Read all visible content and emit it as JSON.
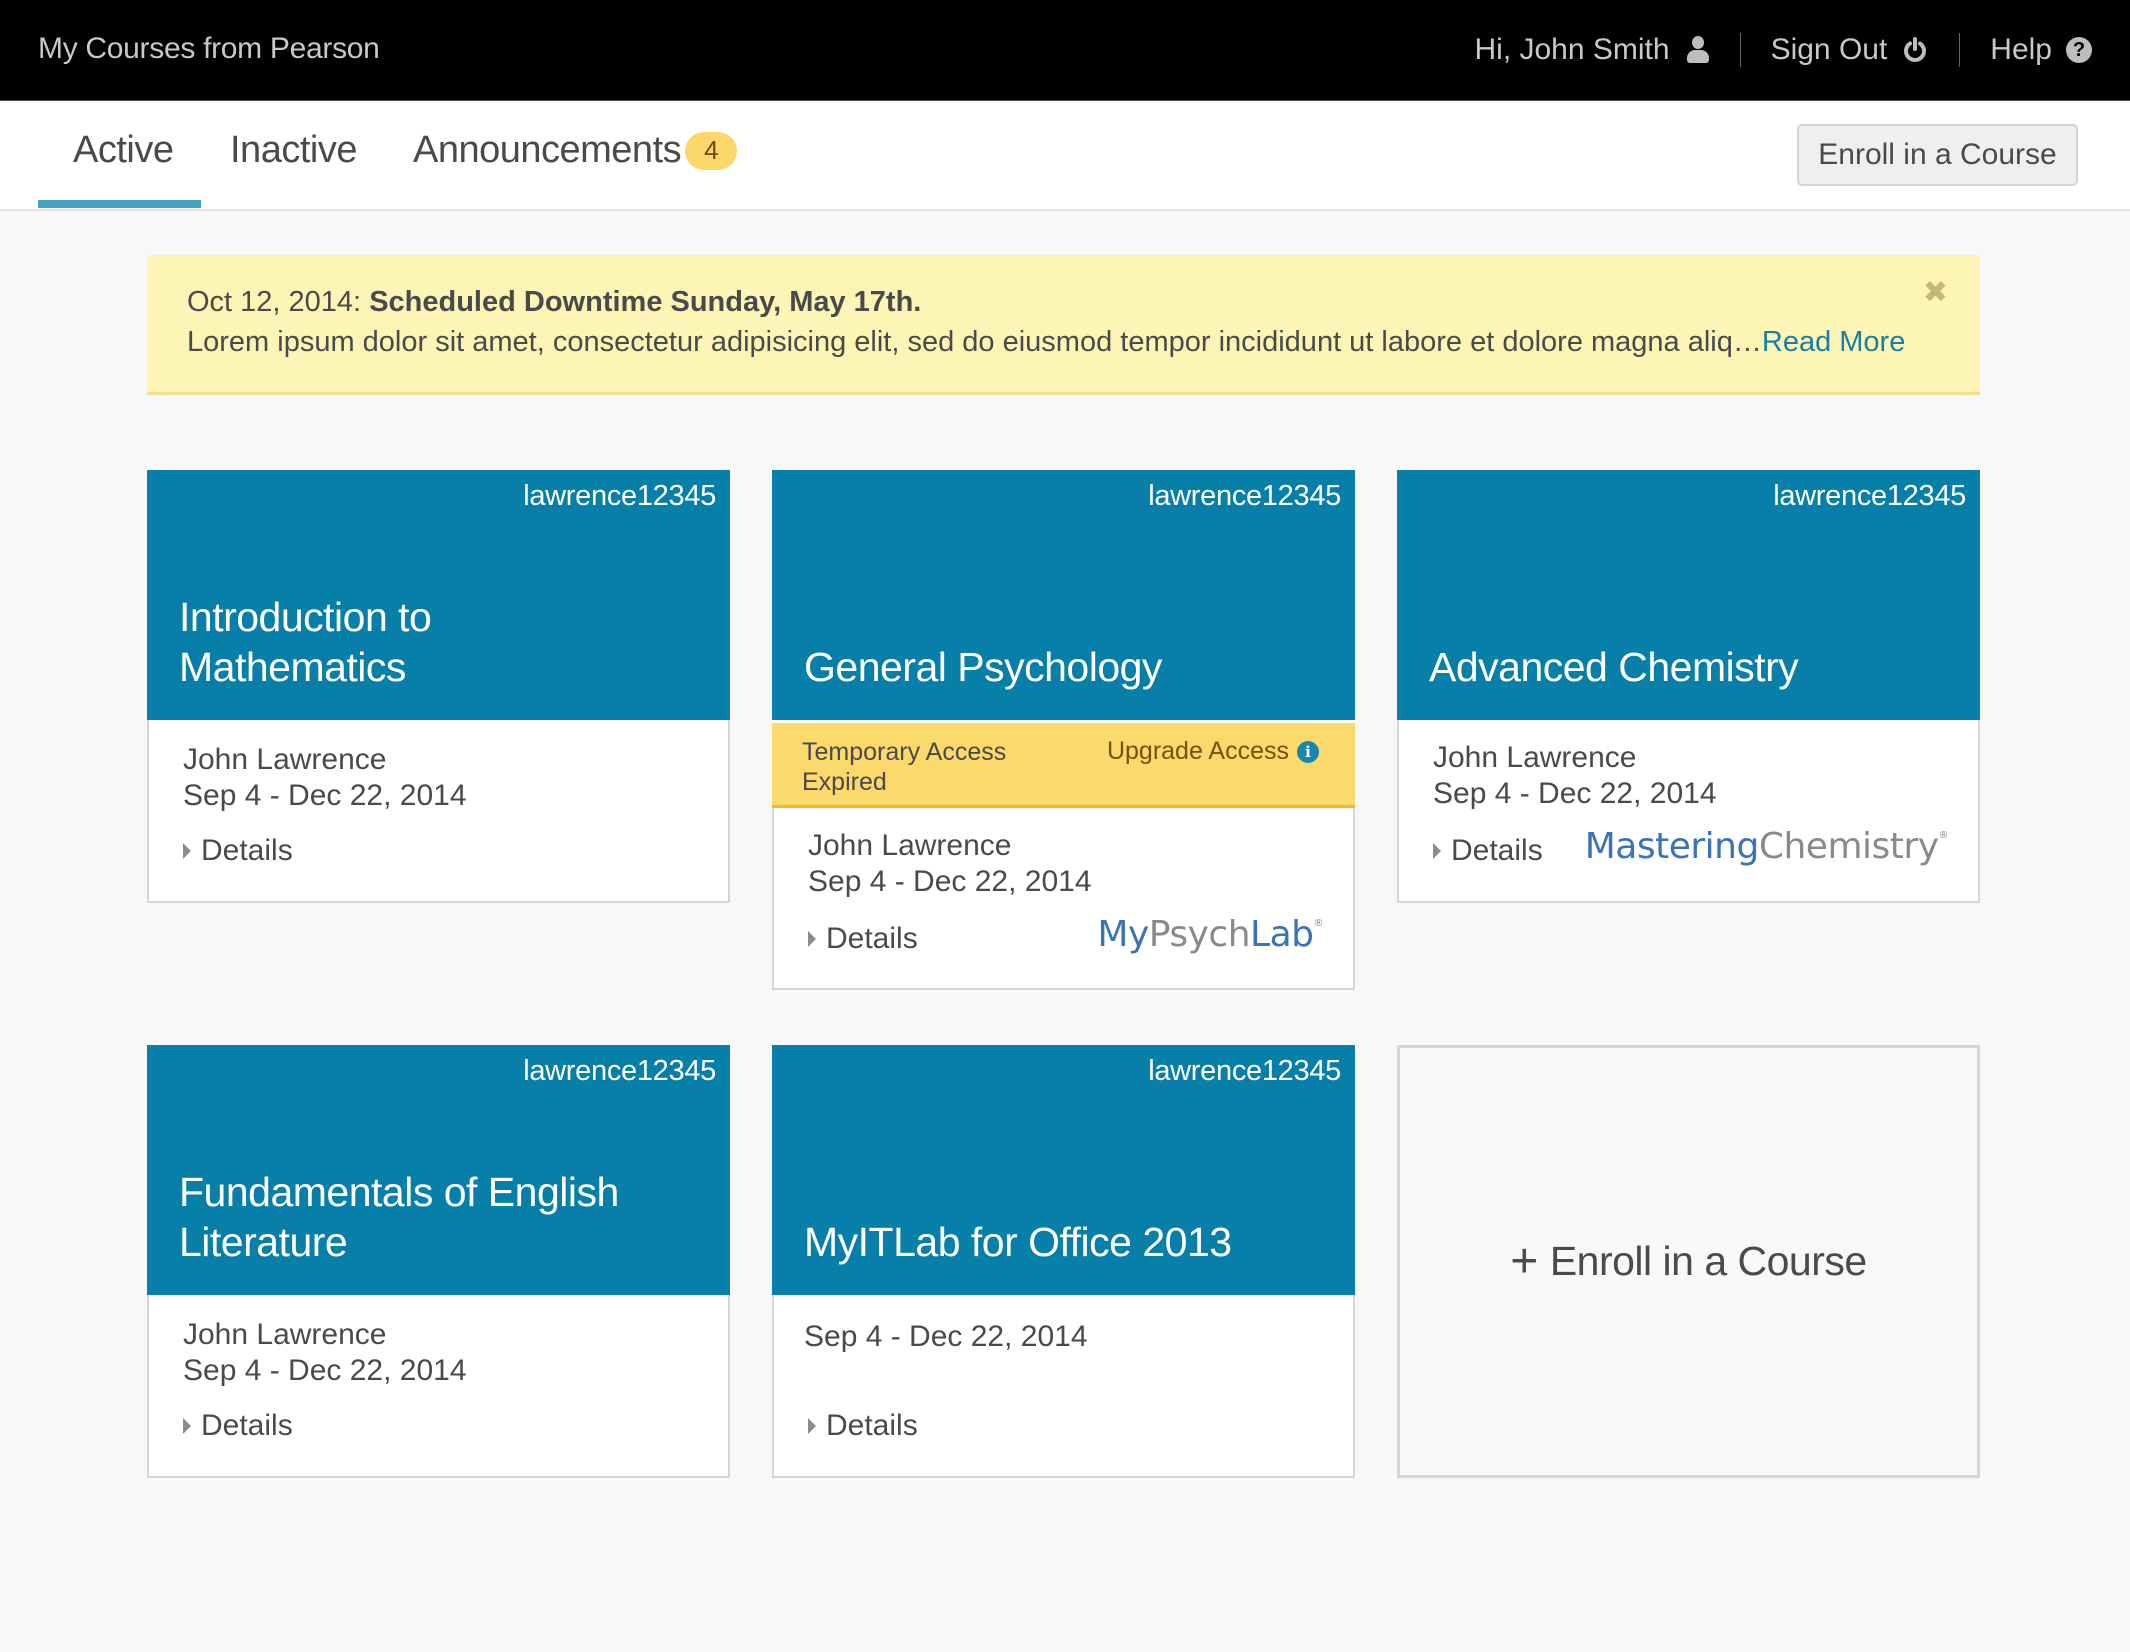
{
  "header": {
    "brand": "My Courses from Pearson",
    "greeting": "Hi, John Smith",
    "sign_out": "Sign Out",
    "help": "Help",
    "icons": {
      "user": "user-icon",
      "power": "power-icon",
      "help": "question-circle-icon"
    }
  },
  "tabs": [
    {
      "label": "Active",
      "active": true
    },
    {
      "label": "Inactive",
      "active": false
    },
    {
      "label": "Announcements",
      "active": false,
      "badge": "4"
    }
  ],
  "toolbar": {
    "enroll_label": "Enroll in a Course"
  },
  "announcement": {
    "date": "Oct 12, 2014:",
    "title": "Scheduled Downtime Sunday, May 17th.",
    "body": "Lorem ipsum dolor sit amet, consectetur adipisicing elit, sed do eiusmod tempor incididunt ut labore et dolore magna aliq…",
    "read_more": "Read More",
    "close_icon": "✖"
  },
  "details_label": "Details",
  "courses": [
    {
      "code": "lawrence12345",
      "title": "Introduction to Mathematics",
      "instructor": "John Lawrence",
      "dates": "Sep 4 - Dec 22, 2014"
    },
    {
      "code": "lawrence12345",
      "title": "General Psychology",
      "status": "Temporary Access Expired",
      "upgrade": "Upgrade Access",
      "instructor": "John Lawrence",
      "dates": "Sep 4 - Dec 22, 2014",
      "logo": {
        "part1": "My",
        "part2": "Psych",
        "part3": "Lab",
        "mark": "®"
      }
    },
    {
      "code": "lawrence12345",
      "title": "Advanced Chemistry",
      "instructor": "John Lawrence",
      "dates": "Sep 4 - Dec 22, 2014",
      "logo": {
        "part1": "Mastering",
        "part2": "Chemistry",
        "mark": "®"
      }
    },
    {
      "code": "lawrence12345",
      "title": "Fundamentals of English Literature",
      "instructor": "John Lawrence",
      "dates": "Sep 4 - Dec 22, 2014"
    },
    {
      "code": "lawrence12345",
      "title": "MyITLab for Office 2013",
      "dates": "Sep 4 - Dec 22, 2014"
    }
  ],
  "enroll_card": {
    "plus": "+",
    "label": "Enroll in a Course"
  },
  "colors": {
    "card_header": "#077fa8",
    "tab_underline": "#45a0c2",
    "badge": "#fcd76a",
    "banner": "#fdf5b5",
    "temp_access": "#fcd96b",
    "link": "#1a7fa0"
  }
}
